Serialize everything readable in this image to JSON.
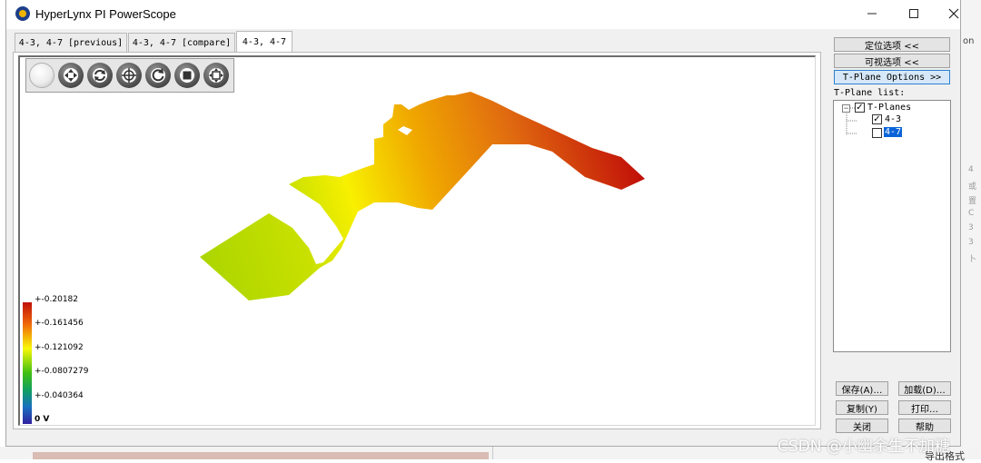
{
  "window": {
    "title": "HyperLynx PI PowerScope",
    "controls": [
      "minimize",
      "maximize",
      "close"
    ]
  },
  "tabs": [
    {
      "label": "4-3, 4-7 [previous]",
      "active": false
    },
    {
      "label": "4-3, 4-7 [compare]",
      "active": false
    },
    {
      "label": "4-3, 4-7",
      "active": true
    }
  ],
  "toolbar": {
    "icons": [
      "sphere-icon",
      "pan-icon",
      "rotate-icon",
      "target-icon",
      "reset-view-icon",
      "stop-icon",
      "fit-icon"
    ]
  },
  "legend": {
    "labels": [
      "+-0.20182",
      "+-0.161456",
      "+-0.121092",
      "+-0.0807279",
      "+-0.040364",
      "0 V"
    ],
    "colors": [
      "#c01008",
      "#f06808",
      "#f8f808",
      "#40c010",
      "#10a060",
      "#3020a0"
    ]
  },
  "panel": {
    "locate_options": "定位选项 <<",
    "visual_options": "可视选项 <<",
    "tplane_options": "T-Plane Options >>",
    "tplane_list_label": "T-Plane list:",
    "tree": {
      "root": "T-Planes",
      "items": [
        {
          "label": "4-3",
          "checked": true,
          "selected": false
        },
        {
          "label": "4-7",
          "checked": false,
          "selected": true
        }
      ]
    },
    "buttons": {
      "save": "保存(A)…",
      "load": "加载(D)…",
      "copy": "复制(Y)",
      "print": "打印…",
      "close": "关闭",
      "help": "帮助"
    }
  },
  "background_text": {
    "right_top": "on",
    "bottom_right": "导出格式"
  },
  "watermark": "CSDN @小幽余生不加糖",
  "colors": {
    "accent": "#2d7fd0",
    "selection": "#0a64d8",
    "plane_high": "#c01008",
    "plane_low": "#90d000"
  }
}
